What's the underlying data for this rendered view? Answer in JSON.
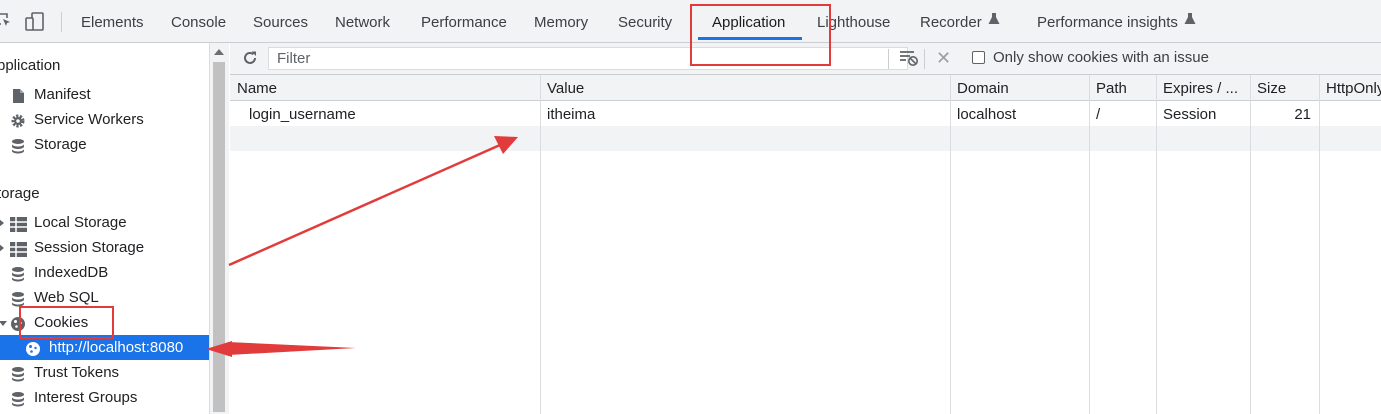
{
  "tabs": [
    {
      "label": "Elements"
    },
    {
      "label": "Console"
    },
    {
      "label": "Sources"
    },
    {
      "label": "Network"
    },
    {
      "label": "Performance"
    },
    {
      "label": "Memory"
    },
    {
      "label": "Security"
    },
    {
      "label": "Application"
    },
    {
      "label": "Lighthouse"
    },
    {
      "label": "Recorder"
    },
    {
      "label": "Performance insights"
    }
  ],
  "active_tab": "Application",
  "sidebar": {
    "application_title": "pplication",
    "application_items": [
      {
        "label": "Manifest",
        "icon": "file-icon"
      },
      {
        "label": "Service Workers",
        "icon": "gear-icon"
      },
      {
        "label": "Storage",
        "icon": "database-icon"
      }
    ],
    "storage_title": "torage",
    "storage_items": [
      {
        "label": "Local Storage",
        "icon": "grid-icon",
        "expandable": true
      },
      {
        "label": "Session Storage",
        "icon": "grid-icon",
        "expandable": true
      },
      {
        "label": "IndexedDB",
        "icon": "database-icon"
      },
      {
        "label": "Web SQL",
        "icon": "database-icon"
      },
      {
        "label": "Cookies",
        "icon": "cookie-icon",
        "expanded": true
      },
      {
        "label": "http://localhost:8080",
        "icon": "cookie-icon",
        "selected": true
      },
      {
        "label": "Trust Tokens",
        "icon": "database-icon"
      },
      {
        "label": "Interest Groups",
        "icon": "database-icon"
      }
    ]
  },
  "toolbar": {
    "filter_placeholder": "Filter",
    "only_issues_label": "Only show cookies with an issue",
    "only_issues_checked": false
  },
  "table": {
    "columns": [
      "Name",
      "Value",
      "Domain",
      "Path",
      "Expires / ...",
      "Size",
      "HttpOnly"
    ],
    "rows": [
      {
        "name": "login_username",
        "value": "itheima",
        "domain": "localhost",
        "path": "/",
        "expires": "Session",
        "size": "21",
        "httponly": ""
      }
    ]
  },
  "colors": {
    "accent": "#1a73e8",
    "annotation": "#e23b3b",
    "toolbar_bg": "#f1f3f4"
  }
}
